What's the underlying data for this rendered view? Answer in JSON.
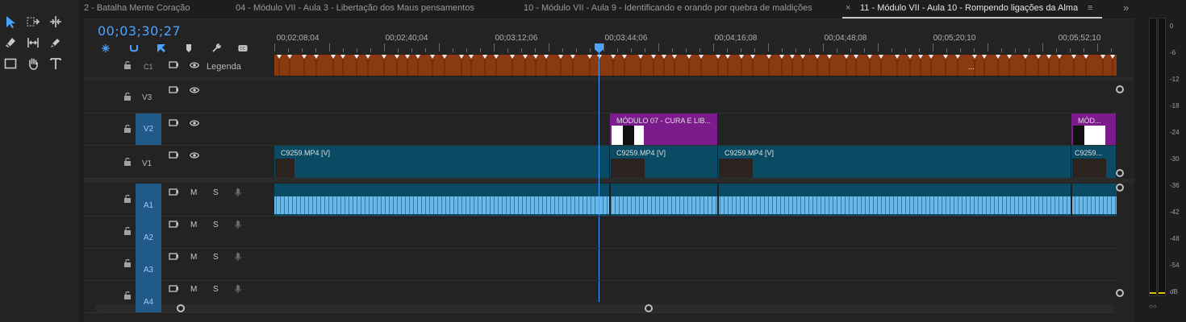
{
  "tabs": [
    {
      "label": "2 - Batalha Mente Coração",
      "active": false
    },
    {
      "label": "04 - Módulo VII  - Aula 3 - Libertação dos Maus pensamentos",
      "active": false
    },
    {
      "label": "10 - Módulo VII - Aula 9 - Identificando e orando por quebra de maldições",
      "active": false
    },
    {
      "label": "11 - Módulo VII - Aula 10 - Rompendo ligações da Alma",
      "active": true
    }
  ],
  "tab_close_icon": "×",
  "tab_menu_icon": "≡",
  "tab_overflow_icon": "»",
  "timecode": "00;03;30;27",
  "ruler_labels": [
    "00;02;08;04",
    "00;02;40;04",
    "00;03;12;06",
    "00;03;44;06",
    "00;04;16;08",
    "00;04;48;08",
    "00;05;20;10",
    "00;05;52;10"
  ],
  "tracks": {
    "caption": {
      "name": "C1",
      "label": "Legenda"
    },
    "video": [
      {
        "name": "V3"
      },
      {
        "name": "V2"
      },
      {
        "name": "V1"
      }
    ],
    "audio": [
      {
        "name": "A1",
        "m": "M",
        "s": "S"
      },
      {
        "name": "A2",
        "m": "M",
        "s": "S"
      },
      {
        "name": "A3",
        "m": "M",
        "s": "S"
      },
      {
        "name": "A4",
        "m": "M",
        "s": "S"
      }
    ]
  },
  "clips": {
    "v2": [
      {
        "label": "MÓDULO 07 - CURA E LIB..."
      },
      {
        "label": "MÓD..."
      }
    ],
    "v1": [
      {
        "label": "C9259.MP4 [V]"
      },
      {
        "label": "C9259.MP4 [V]"
      },
      {
        "label": "C9259.MP4 [V]"
      },
      {
        "label": "C9259..."
      }
    ],
    "caption_ellipsis": "..."
  },
  "meter_db": [
    "0",
    "-6",
    "-12",
    "-18",
    "-24",
    "-30",
    "-36",
    "-42",
    "-48",
    "-54",
    "dB"
  ],
  "colors": {
    "accent": "#4aa3ff",
    "caption": "#8b3a0f",
    "video_clip": "#0b4a63",
    "title_clip": "#7c1b8c",
    "track_target": "#1f5a8a"
  }
}
